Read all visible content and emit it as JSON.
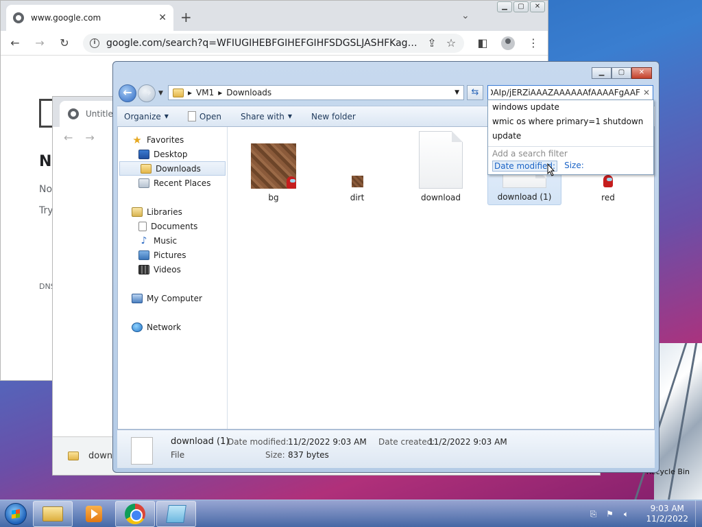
{
  "desktop": {
    "recycle_bin": "Recycle Bin"
  },
  "chrome": {
    "tab_title": "www.google.com",
    "url": "google.com/search?q=WFIUGIHEBFGIHEFGIHFSDGSLJASHFKagsaaaaaaaaa...",
    "body_heading": "N",
    "body_line1": "No",
    "body_line2": "Try",
    "body_line3": "DNS"
  },
  "chrome2": {
    "tab_title": "Untitled",
    "download_name": "downl"
  },
  "explorer": {
    "breadcrumb": [
      "VM1",
      "Downloads"
    ],
    "search_value": "DAIp/jERZiAAAZAAAAAAfAAAAFgAAF",
    "toolbar": {
      "organize": "Organize",
      "open": "Open",
      "share_with": "Share with",
      "new_folder": "New folder"
    },
    "nav": {
      "favorites": "Favorites",
      "desktop": "Desktop",
      "downloads": "Downloads",
      "recent_places": "Recent Places",
      "libraries": "Libraries",
      "documents": "Documents",
      "music": "Music",
      "pictures": "Pictures",
      "videos": "Videos",
      "my_computer": "My Computer",
      "network": "Network"
    },
    "files": [
      {
        "name": "bg"
      },
      {
        "name": "dirt"
      },
      {
        "name": "download"
      },
      {
        "name": "download (1)"
      },
      {
        "name": "red"
      }
    ],
    "suggestions": [
      "windows update",
      "wmic os where primary=1 shutdown",
      "update"
    ],
    "search_filter_hint": "Add a search filter",
    "filter_date": "Date modified:",
    "filter_size": "Size:",
    "status": {
      "name": "download (1)",
      "type": "File",
      "date_modified_label": "Date modified:",
      "date_modified": "11/2/2022 9:03 AM",
      "date_created_label": "Date created:",
      "date_created": "11/2/2022 9:03 AM",
      "size_label": "Size:",
      "size": "837 bytes"
    }
  },
  "taskbar": {
    "time": "9:03 AM",
    "date": "11/2/2022"
  }
}
